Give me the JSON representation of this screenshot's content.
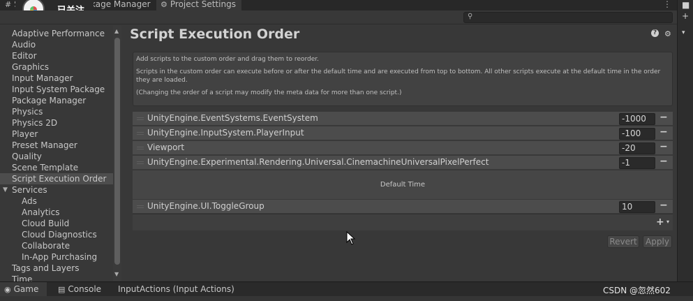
{
  "top_tabs": {
    "scene_prefix": "S",
    "package_manager": "kage Manager",
    "project_settings": "Project Settings",
    "scene_icon": "#",
    "settings_icon": "⚙",
    "menu_icon": "⋮"
  },
  "follow_overlay": {
    "label": "已关注"
  },
  "search": {
    "icon": "⚲",
    "placeholder": ""
  },
  "sidebar": {
    "items": [
      {
        "label": "Adaptive Performance"
      },
      {
        "label": "Audio"
      },
      {
        "label": "Editor"
      },
      {
        "label": "Graphics"
      },
      {
        "label": "Input Manager"
      },
      {
        "label": "Input System Package"
      },
      {
        "label": "Package Manager"
      },
      {
        "label": "Physics"
      },
      {
        "label": "Physics 2D"
      },
      {
        "label": "Player"
      },
      {
        "label": "Preset Manager"
      },
      {
        "label": "Quality"
      },
      {
        "label": "Scene Template"
      },
      {
        "label": "Script Execution Order"
      },
      {
        "label": "Services"
      },
      {
        "label": "Ads"
      },
      {
        "label": "Analytics"
      },
      {
        "label": "Cloud Build"
      },
      {
        "label": "Cloud Diagnostics"
      },
      {
        "label": "Collaborate"
      },
      {
        "label": "In-App Purchasing"
      },
      {
        "label": "Tags and Layers"
      },
      {
        "label": "Time"
      }
    ],
    "selected": "Script Execution Order"
  },
  "main": {
    "title": "Script Execution Order",
    "help_icon": "?",
    "gear_icon": "⚙",
    "info": {
      "line1": "Add scripts to the custom order and drag them to reorder.",
      "line2": "Scripts in the custom order can execute before or after the default time and are executed from top to bottom. All other scripts execute at the default time in the order they are loaded.",
      "line3": "(Changing the order of a script may modify the meta data for more than one script.)"
    },
    "scripts_before": [
      {
        "name": "UnityEngine.EventSystems.EventSystem",
        "order": "-1000"
      },
      {
        "name": "UnityEngine.InputSystem.PlayerInput",
        "order": "-100"
      },
      {
        "name": "Viewport",
        "order": "-20"
      },
      {
        "name": "UnityEngine.Experimental.Rendering.Universal.CinemachineUniversalPixelPerfect",
        "order": "-1"
      }
    ],
    "default_time_label": "Default Time",
    "scripts_after": [
      {
        "name": "UnityEngine.UI.ToggleGroup",
        "order": "10"
      }
    ],
    "remove_icon": "−",
    "add_icon": "+",
    "add_dropdown_icon": "▾",
    "revert_label": "Revert",
    "apply_label": "Apply"
  },
  "bottom_tabs": {
    "game": "Game",
    "console": "Console",
    "input_actions": "InputActions (Input Actions)",
    "game_icon": "◉",
    "console_icon": "▤"
  },
  "watermark": "CSDN @忽然602"
}
